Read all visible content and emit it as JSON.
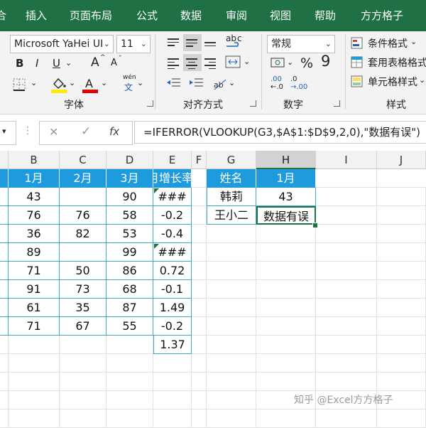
{
  "ribbon_tabs": [
    "合",
    "插入",
    "页面布局",
    "公式",
    "数据",
    "审阅",
    "视图",
    "帮助",
    "方方格子"
  ],
  "font": {
    "name": "Microsoft YaHei UI",
    "size": "11",
    "bold": "B",
    "italic": "I",
    "underline": "U",
    "grow": "A",
    "shrink": "A",
    "phonetic_top": "wén",
    "phonetic_bottom": "文",
    "group_label": "字体"
  },
  "alignment": {
    "group_label": "对齐方式",
    "wrap_glyph": "ab",
    "wrap_glyph2": "c"
  },
  "number": {
    "format": "常规",
    "percent": "%",
    "comma": "9",
    "group_label": "数字",
    "inc": ".00",
    "dec": ".0"
  },
  "styles": {
    "conditional": "条件格式",
    "table": "套用表格格式",
    "cell": "单元格样式",
    "group_label": "样式"
  },
  "formula_bar": {
    "cancel": "✕",
    "confirm": "✓",
    "fx": "fx",
    "formula": "=IFERROR(VLOOKUP(G3,$A$1:$D$9,2,0),\"数据有误\")"
  },
  "columns": [
    "B",
    "C",
    "D",
    "E",
    "F",
    "G",
    "H",
    "I",
    "J"
  ],
  "table_header": {
    "b": "1月",
    "c": "2月",
    "d": "3月",
    "e": "月增长率"
  },
  "table_rows": [
    {
      "b": "43",
      "c": "",
      "d": "90",
      "e": "###"
    },
    {
      "b": "76",
      "c": "76",
      "d": "58",
      "e": "-0.2"
    },
    {
      "b": "36",
      "c": "82",
      "d": "53",
      "e": "-0.4"
    },
    {
      "b": "89",
      "c": "",
      "d": "99",
      "e": "###"
    },
    {
      "b": "71",
      "c": "50",
      "d": "86",
      "e": "0.72"
    },
    {
      "b": "91",
      "c": "73",
      "d": "68",
      "e": "-0.1"
    },
    {
      "b": "61",
      "c": "35",
      "d": "87",
      "e": "1.49"
    },
    {
      "b": "71",
      "c": "67",
      "d": "55",
      "e": "-0.2"
    },
    {
      "b": "",
      "c": "",
      "d": "",
      "e": "1.37"
    }
  ],
  "lookup": {
    "header": [
      "姓名",
      "1月"
    ],
    "rows": [
      [
        "韩莉",
        "43"
      ],
      [
        "王小二",
        "数据有误"
      ]
    ]
  },
  "watermark": "知乎 @Excel方方格子",
  "colors": {
    "ribbon": "#1f7145",
    "table_header": "#1e9bdc",
    "table_border": "#3fa9c9",
    "selection": "#217346"
  },
  "icons": [
    "align-top-icon",
    "align-middle-icon",
    "align-bottom-icon",
    "wrap-text-icon",
    "indent-icon",
    "merge-icon",
    "border-icon",
    "fill-color-icon",
    "font-color-icon",
    "dropdown-arrow-icon",
    "launcher-icon"
  ]
}
